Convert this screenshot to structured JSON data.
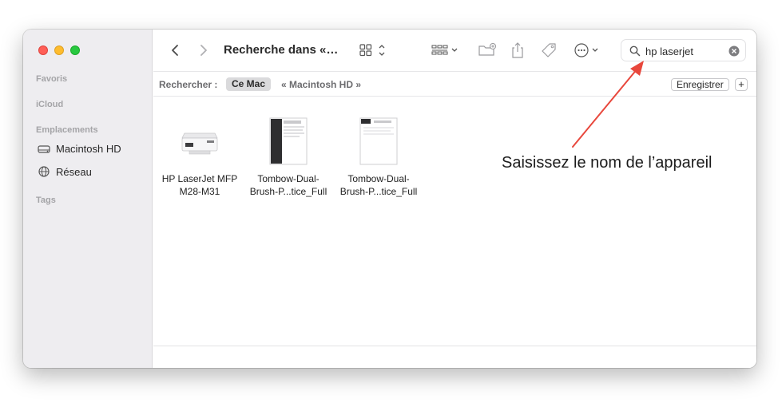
{
  "sidebar": {
    "sections": {
      "favorites": "Favoris",
      "icloud": "iCloud",
      "locations": "Emplacements",
      "tags": "Tags"
    },
    "items": [
      {
        "label": "Macintosh HD",
        "icon": "disk-icon"
      },
      {
        "label": "Réseau",
        "icon": "globe-icon"
      }
    ]
  },
  "toolbar": {
    "title": "Recherche dans «…",
    "search": {
      "value": "hp laserjet",
      "placeholder": "Rechercher"
    }
  },
  "scopebar": {
    "label": "Rechercher :",
    "selected": "Ce Mac",
    "other": "« Macintosh HD »",
    "save_label": "Enregistrer",
    "add_label": "+"
  },
  "files": [
    {
      "name": "HP LaserJet MFP M28-M31",
      "icon": "printer-icon"
    },
    {
      "name": "Tombow-Dual-Brush-P...tice_Full",
      "icon": "document-icon"
    },
    {
      "name": "Tombow-Dual-Brush-P...tice_Full",
      "icon": "document-icon"
    }
  ],
  "annotation": {
    "text": "Saisissez le nom de l’appareil",
    "arrow_color": "#e8473c"
  },
  "colors": {
    "close": "#ff5f57",
    "minimize": "#febc2e",
    "zoom": "#28c840",
    "sidebar_bg": "#eeedf0"
  }
}
